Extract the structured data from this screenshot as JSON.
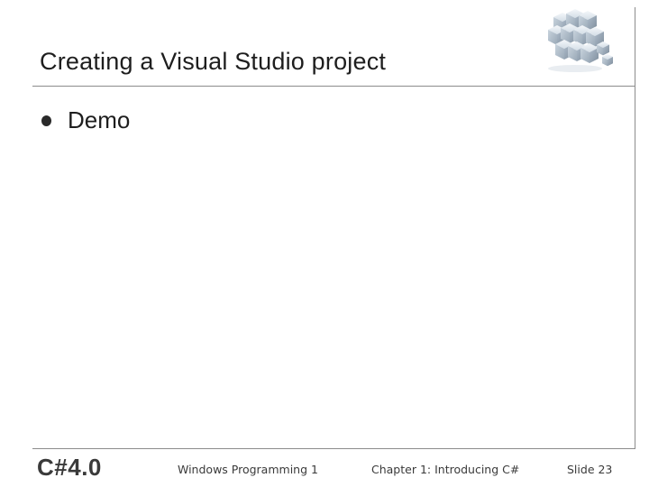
{
  "slide": {
    "title": "Creating a Visual Studio project",
    "bullets": [
      {
        "text": "Demo"
      }
    ],
    "logo_icon": "stacked-cubes-logo-icon"
  },
  "footer": {
    "brand": "C#4.0",
    "course": "Windows Programming 1",
    "chapter": "Chapter 1: Introducing C#",
    "slide_number": "Slide 23"
  },
  "colors": {
    "frame_line": "#8c8c8c",
    "text": "#1e1e1e",
    "cube_light": "#e6edf3",
    "cube_mid": "#b9c6d2",
    "cube_dark": "#7f8e9c"
  }
}
